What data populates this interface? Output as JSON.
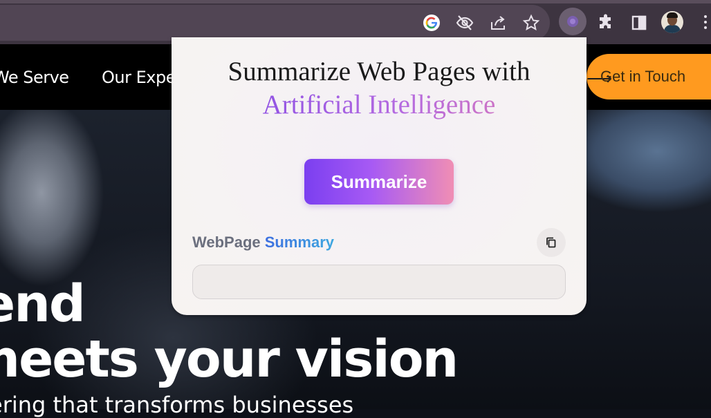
{
  "browser": {
    "icons": [
      "google-icon",
      "eye-off-icon",
      "share-icon",
      "star-icon",
      "extension-active-icon",
      "puzzle-icon",
      "side-panel-icon",
      "avatar",
      "more-icon"
    ]
  },
  "site": {
    "nav": {
      "item1": "We Serve",
      "item2": "Our Expe",
      "cta_label": "Get in Touch"
    },
    "hero": {
      "line1": "end",
      "line2": "meets your vision",
      "line3": "ering that transforms businesses"
    }
  },
  "popup": {
    "title_line1": "Summarize Web Pages with",
    "title_line2": "Artificial Intelligence",
    "summarize_label": "Summarize",
    "summary_heading_part1": "WebPage ",
    "summary_heading_part2": "Summary",
    "summary_value": ""
  },
  "colors": {
    "cta": "#ff9a1f",
    "button_start": "#7b3ff0",
    "button_end": "#f08eb4",
    "accent_blue": "#3d6fe0"
  }
}
